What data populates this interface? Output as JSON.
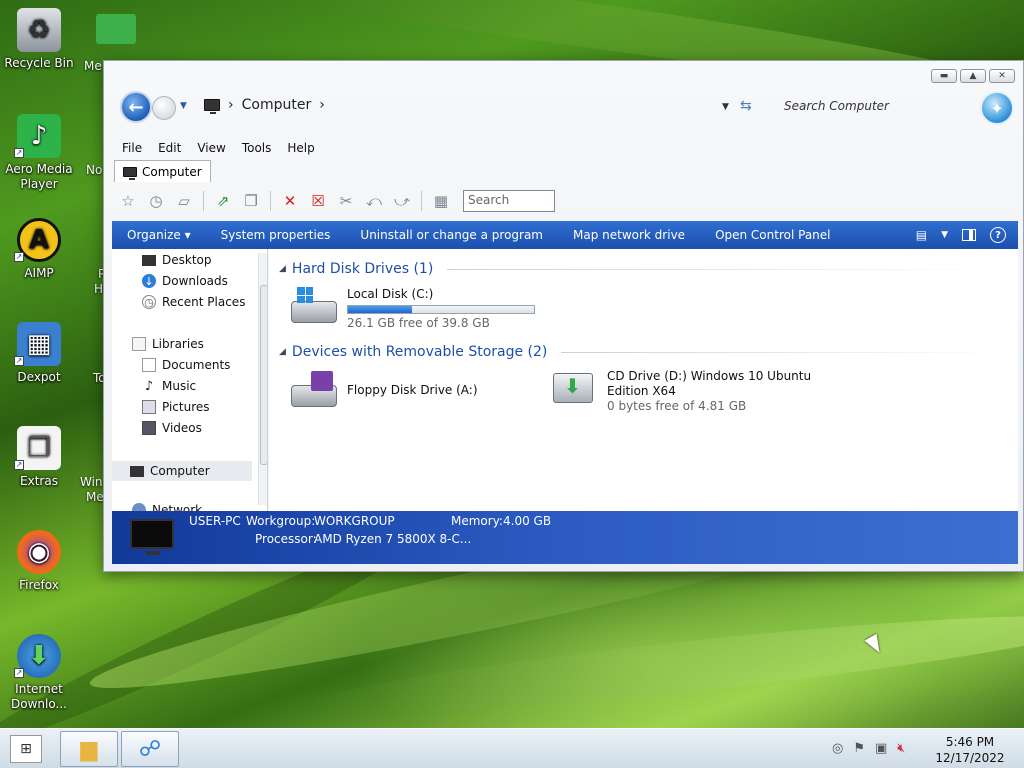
{
  "desktop": {
    "icons": [
      {
        "label": "Recycle Bin",
        "glyph": "♻"
      },
      {
        "label": "Aero Media Player",
        "glyph": "♪"
      },
      {
        "label": "AIMP",
        "glyph": "A"
      },
      {
        "label": "Dexpot",
        "glyph": "▦"
      },
      {
        "label": "Extras",
        "glyph": "❐"
      },
      {
        "label": "Firefox",
        "glyph": "◉"
      },
      {
        "label": "Internet Downlo...",
        "glyph": "⬇"
      }
    ],
    "partial_labels": [
      "Me",
      "No",
      "P",
      "H",
      "To",
      "Win",
      "Me"
    ]
  },
  "window": {
    "address": {
      "root": "Computer",
      "sep": "›"
    },
    "search_placeholder": "Search Computer",
    "menu": [
      "File",
      "Edit",
      "View",
      "Tools",
      "Help"
    ],
    "tab_label": "Computer",
    "toolbar_search_placeholder": "Search",
    "commands": [
      "Organize ▾",
      "System properties",
      "Uninstall or change a program",
      "Map network drive",
      "Open Control Panel"
    ],
    "nav": {
      "favorites": [
        "Desktop",
        "Downloads",
        "Recent Places"
      ],
      "libraries_label": "Libraries",
      "libraries": [
        "Documents",
        "Music",
        "Pictures",
        "Videos"
      ],
      "computer_label": "Computer",
      "network_label": "Network"
    },
    "groups": {
      "hdd_title": "Hard Disk Drives (1)",
      "removable_title": "Devices with Removable Storage (2)"
    },
    "drives": {
      "local": {
        "name": "Local Disk (C:)",
        "free": "26.1 GB free of 39.8 GB",
        "used_fraction": 0.344
      },
      "floppy": {
        "name": "Floppy Disk Drive (A:)"
      },
      "cd": {
        "name_line1": "CD Drive (D:) Windows 10 Ubuntu",
        "name_line2": "Edition X64",
        "free": "0 bytes free of 4.81 GB"
      }
    },
    "details": {
      "computer_name": "USER-PC",
      "workgroup_label": "Workgroup:",
      "workgroup": "WORKGROUP",
      "memory_label": "Memory:",
      "memory": "4.00 GB",
      "processor_label": "Processor:",
      "processor": "AMD Ryzen 7 5800X 8-C..."
    }
  },
  "taskbar": {
    "time": "5:46 PM",
    "date": "12/17/2022"
  },
  "colors": {
    "command_bar": "#1d4fae",
    "group_header": "#1e4fa8"
  }
}
